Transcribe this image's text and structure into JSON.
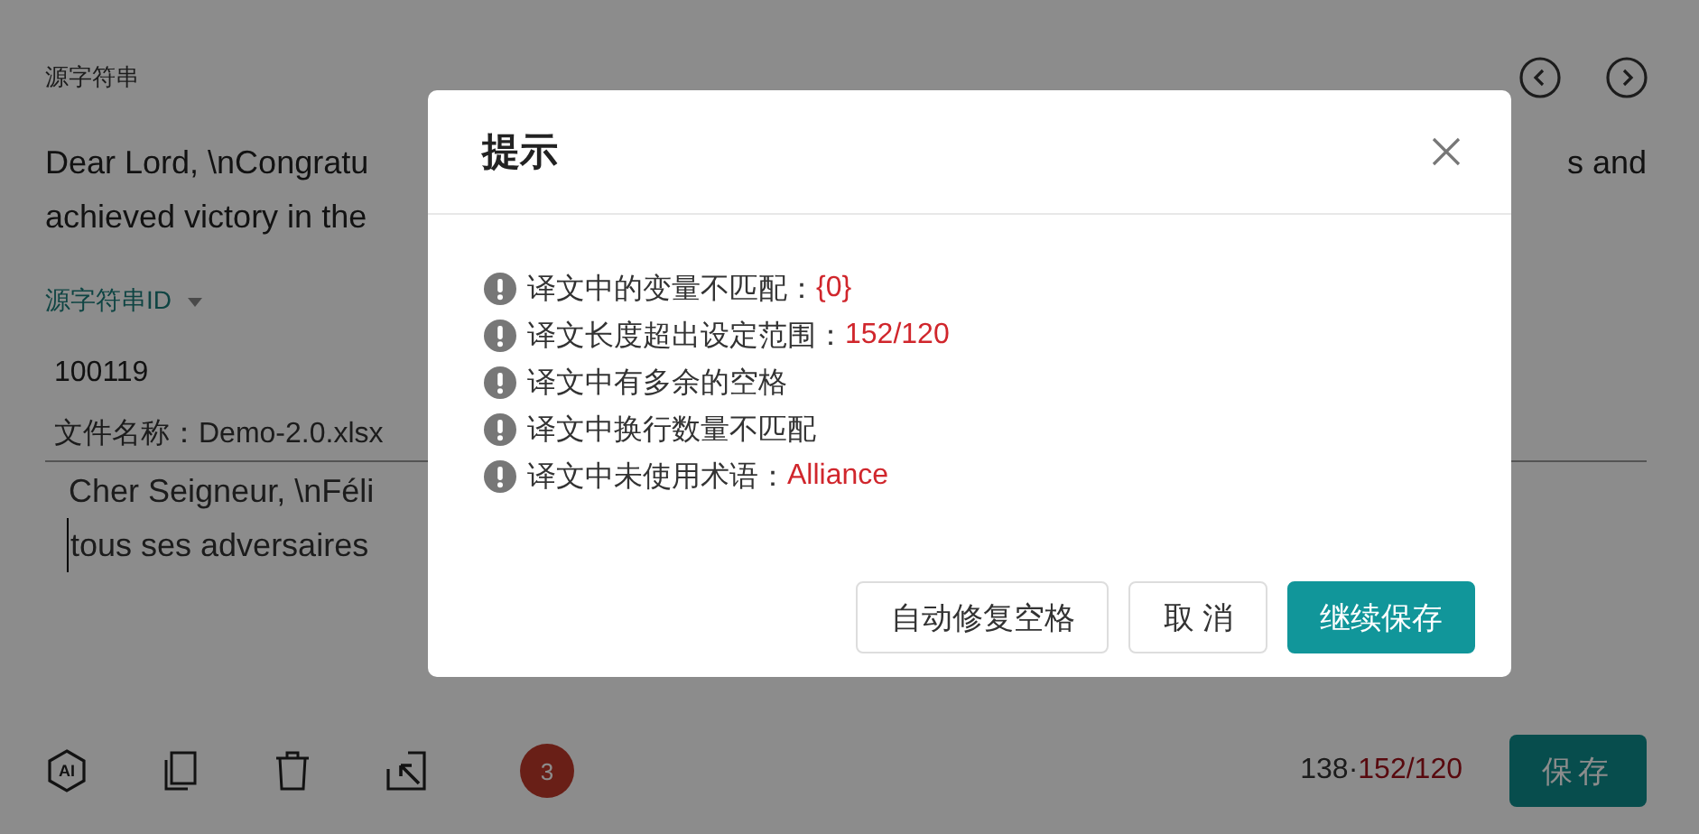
{
  "editor": {
    "source_label": "源字符串",
    "source_lines": [
      {
        "left": "Dear Lord, \\nCongratu",
        "right": "s and"
      },
      {
        "left": "achieved victory in the"
      }
    ],
    "id_label": "源字符串ID",
    "id_value": "100119",
    "file_label": "文件名称：Demo-2.0.xlsx",
    "target_lines": [
      {
        "left": "Cher Seigneur, \\nFéli",
        "caret": false
      },
      {
        "left": "tous ses adversaires",
        "caret": true
      }
    ],
    "toolbar": {
      "ai_label": "AI",
      "badge": "3"
    },
    "counter": {
      "current": "138·",
      "limit": "152/120"
    },
    "save_button": "保存"
  },
  "dialog": {
    "title": "提示",
    "items": [
      {
        "text": "译文中的变量不匹配：",
        "detail": "{0}"
      },
      {
        "text": "译文长度超出设定范围：",
        "detail": "152/120"
      },
      {
        "text": "译文中有多余的空格"
      },
      {
        "text": "译文中换行数量不匹配"
      },
      {
        "text": "译文中未使用术语：",
        "detail": "Alliance"
      }
    ],
    "buttons": [
      {
        "label": "自动修复空格",
        "kind": "default"
      },
      {
        "label": "取 消",
        "kind": "default"
      },
      {
        "label": "继续保存",
        "kind": "primary"
      }
    ]
  }
}
